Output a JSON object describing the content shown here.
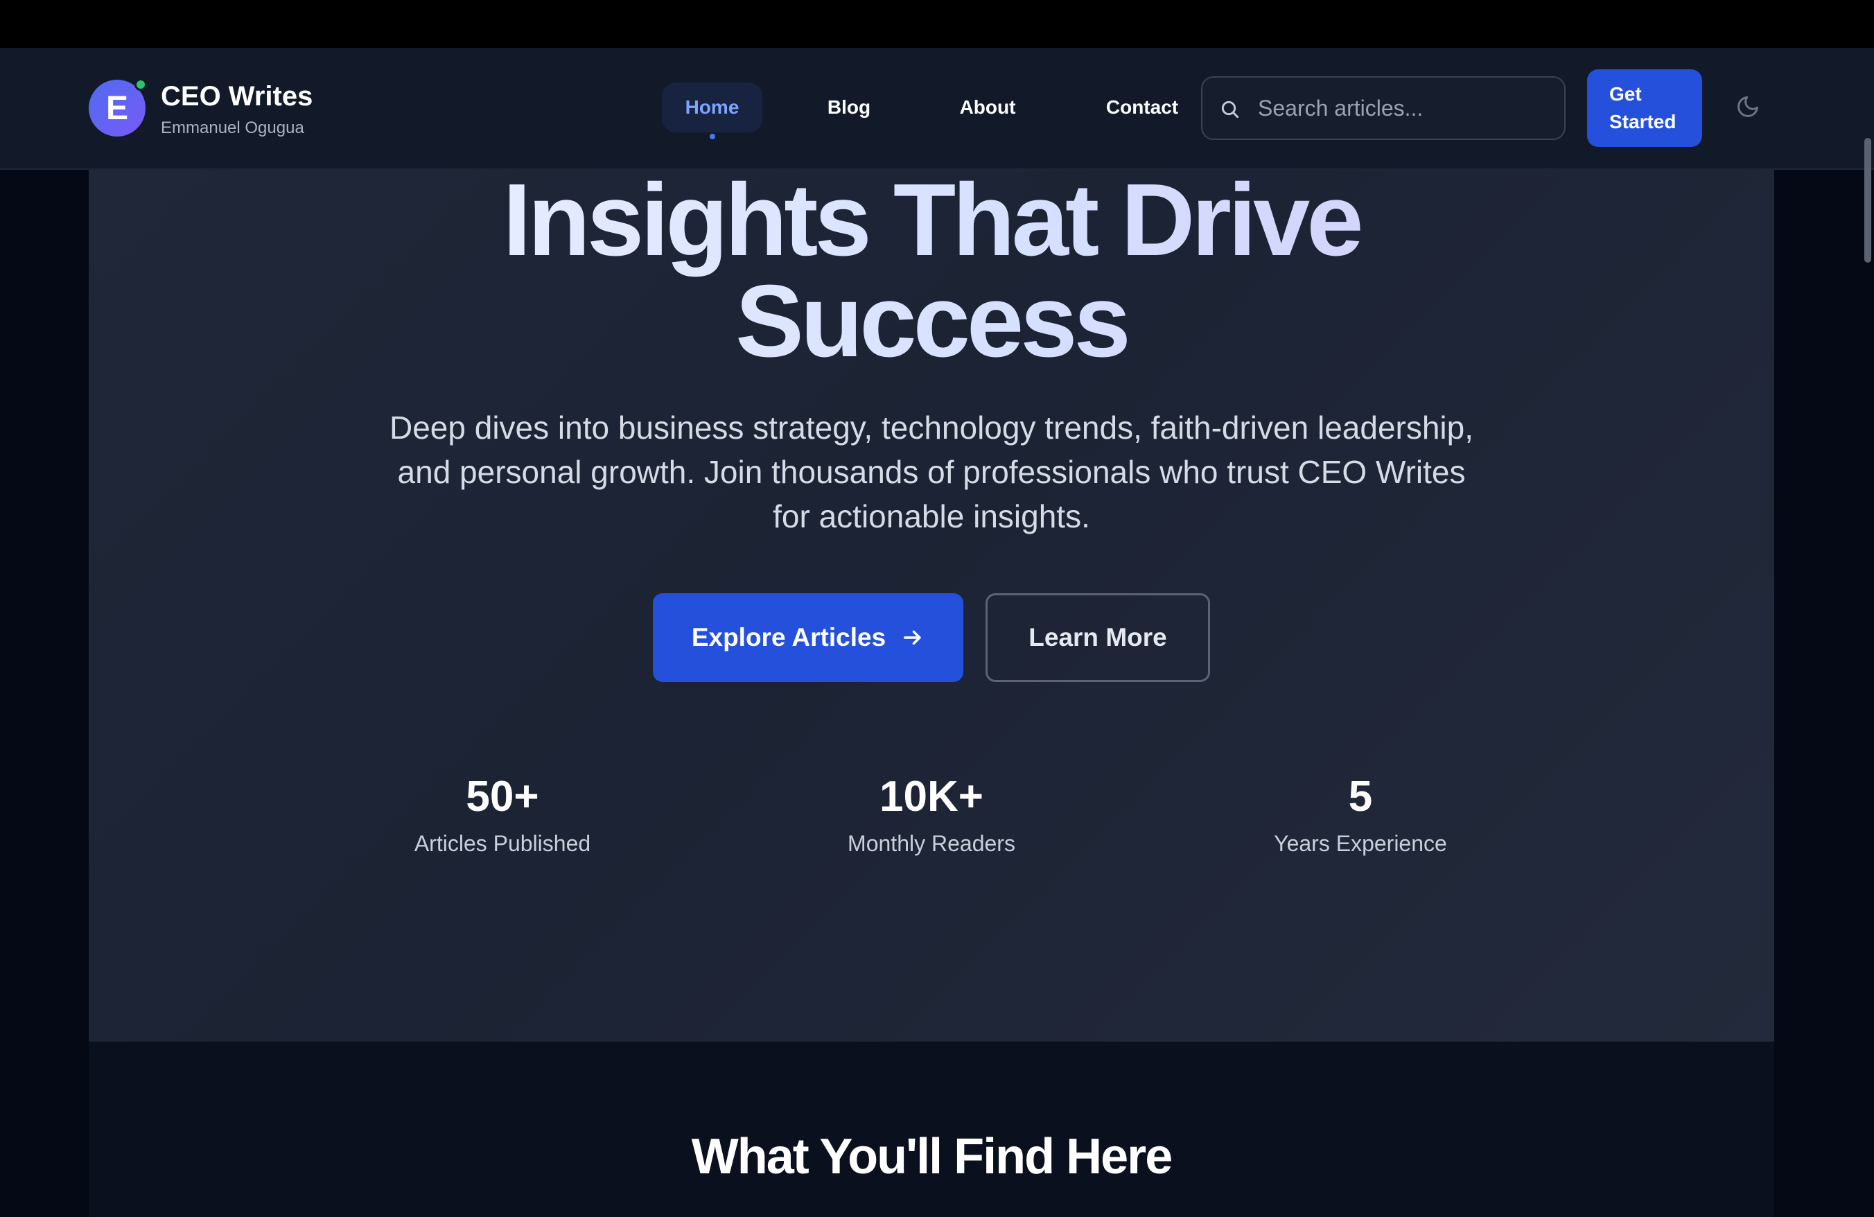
{
  "brand": {
    "logo_letter": "E",
    "title": "CEO Writes",
    "subtitle": "Emmanuel Ogugua"
  },
  "nav": {
    "items": [
      {
        "label": "Home",
        "active": true
      },
      {
        "label": "Blog",
        "active": false
      },
      {
        "label": "About",
        "active": false
      },
      {
        "label": "Contact",
        "active": false
      }
    ],
    "search_placeholder": "Search articles...",
    "cta_label": "Get Started",
    "theme_icon": "moon-icon"
  },
  "hero": {
    "title": "Insights That Drive Success",
    "description": "Deep dives into business strategy, technology trends, faith-driven leadership, and personal growth. Join thousands of professionals who trust CEO Writes for actionable insights.",
    "primary_button": "Explore Articles",
    "secondary_button": "Learn More",
    "stats": [
      {
        "value": "50+",
        "label": "Articles Published"
      },
      {
        "value": "10K+",
        "label": "Monthly Readers"
      },
      {
        "value": "5",
        "label": "Years Experience"
      }
    ]
  },
  "section2": {
    "title": "What You'll Find Here"
  },
  "colors": {
    "accent": "#2450dc",
    "nav_active_text": "#7da4ff",
    "status_dot": "#28c76f",
    "background": "#1f2738"
  }
}
